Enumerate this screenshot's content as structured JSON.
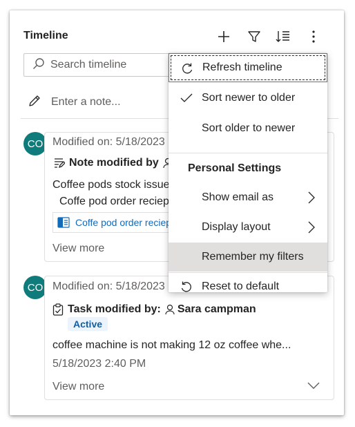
{
  "header": {
    "title": "Timeline",
    "icons": [
      "add-icon",
      "filter-icon",
      "sort-icon",
      "more-icon"
    ]
  },
  "search": {
    "placeholder": "Search timeline"
  },
  "note": {
    "placeholder": "Enter a note..."
  },
  "menu": {
    "items": [
      {
        "label": "Refresh timeline",
        "icon": "refresh-icon"
      },
      {
        "label": "Sort newer to older",
        "icon": "check-icon"
      },
      {
        "label": "Sort older to newer"
      }
    ],
    "section_title": "Personal Settings",
    "settings": [
      {
        "label": "Show email as",
        "icon": "chevron-right-icon"
      },
      {
        "label": "Display layout",
        "icon": "chevron-right-icon"
      },
      {
        "label": "Remember my filters"
      }
    ],
    "reset": {
      "label": "Reset to default",
      "icon": "reset-icon"
    }
  },
  "records": [
    {
      "avatar": "CO",
      "modified": "Modified on: 5/18/2023",
      "title": "Note modified by",
      "line1": "Coffee pods stock issue",
      "line2": "Coffe pod order reciep",
      "attachment": "Coffe pod order reciep",
      "view_more": "View more"
    },
    {
      "avatar": "CO",
      "modified": "Modified on: 5/18/2023",
      "title": "Task modified by:",
      "user": "Sara campman",
      "status": "Active",
      "description": "coffee machine is not making 12 oz coffee whe...",
      "timestamp": "5/18/2023 2:40 PM",
      "view_more": "View more"
    }
  ],
  "colors": {
    "avatar": "#0f7b7b",
    "link": "#0f6cbd",
    "badge_bg": "#ebf3fc",
    "badge_text": "#115ea3"
  }
}
